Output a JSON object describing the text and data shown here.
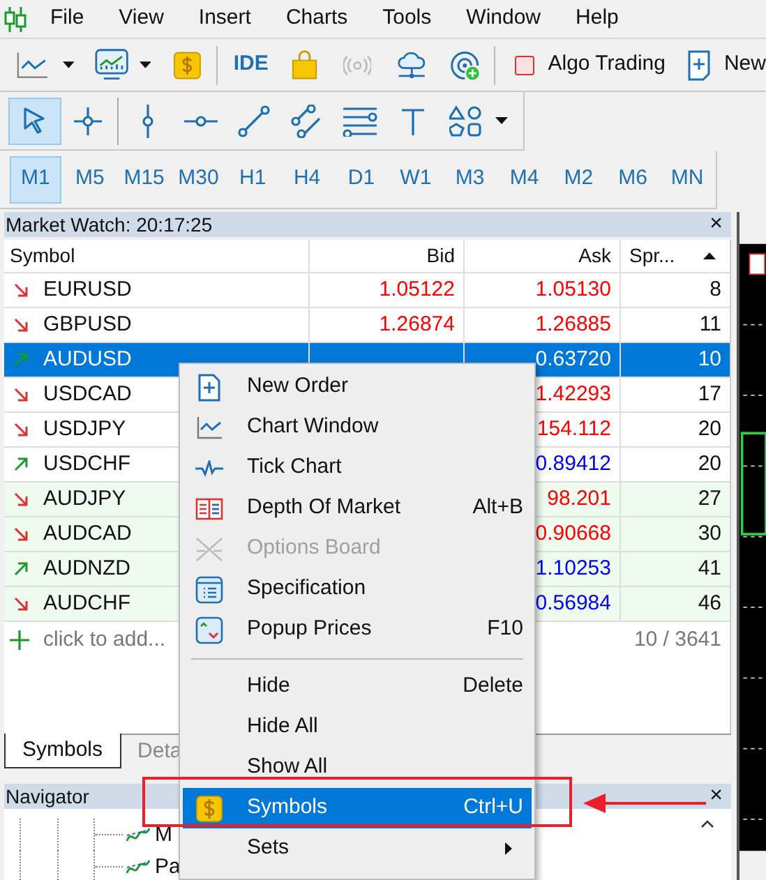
{
  "menubar": [
    "File",
    "View",
    "Insert",
    "Charts",
    "Tools",
    "Window",
    "Help"
  ],
  "toolbar": {
    "ide": "IDE",
    "algo_trading": {
      "label": "Algo Trading",
      "checked": false
    },
    "new_order": "New"
  },
  "drawing_tools": [
    {
      "kind": "cursor",
      "selected": true
    },
    {
      "kind": "crosshair",
      "selected": false
    },
    {
      "kind": "vline",
      "selected": false
    },
    {
      "kind": "hline",
      "selected": false
    },
    {
      "kind": "trend",
      "selected": false
    },
    {
      "kind": "channel",
      "selected": false
    },
    {
      "kind": "fibo",
      "selected": false
    },
    {
      "kind": "text",
      "selected": false
    },
    {
      "kind": "shapes",
      "selected": false
    }
  ],
  "timeframes": [
    {
      "label": "M1",
      "selected": true
    },
    {
      "label": "M5",
      "selected": false
    },
    {
      "label": "M15",
      "selected": false
    },
    {
      "label": "M30",
      "selected": false
    },
    {
      "label": "H1",
      "selected": false
    },
    {
      "label": "H4",
      "selected": false
    },
    {
      "label": "D1",
      "selected": false
    },
    {
      "label": "W1",
      "selected": false
    },
    {
      "label": "M3",
      "selected": false
    },
    {
      "label": "M4",
      "selected": false
    },
    {
      "label": "M2",
      "selected": false
    },
    {
      "label": "M6",
      "selected": false
    },
    {
      "label": "MN",
      "selected": false
    }
  ],
  "market_watch": {
    "title": "Market Watch: 20:17:25",
    "close": "×",
    "columns": [
      "Symbol",
      "Bid",
      "Ask",
      "Spr..."
    ],
    "rows": [
      {
        "symbol": "EURUSD",
        "rising": false,
        "selected": false,
        "tinted": false,
        "bid": {
          "value": "1.05122",
          "color": "#ff0000"
        },
        "ask": {
          "value": "1.05130",
          "color": "#ff0000"
        },
        "spread": "8"
      },
      {
        "symbol": "GBPUSD",
        "rising": false,
        "selected": false,
        "tinted": false,
        "bid": {
          "value": "1.26874",
          "color": "#ff0000"
        },
        "ask": {
          "value": "1.26885",
          "color": "#ff0000"
        },
        "spread": "11"
      },
      {
        "symbol": "AUDUSD",
        "rising": true,
        "selected": true,
        "tinted": false,
        "ask": {
          "value": "0.63720"
        },
        "spread": "10"
      },
      {
        "symbol": "USDCAD",
        "rising": false,
        "selected": false,
        "tinted": false,
        "ask": {
          "value": "1.42293",
          "color": "#ff0000"
        },
        "spread": "17"
      },
      {
        "symbol": "USDJPY",
        "rising": false,
        "selected": false,
        "tinted": false,
        "ask": {
          "value": "154.112",
          "color": "#ff0000"
        },
        "spread": "20"
      },
      {
        "symbol": "USDCHF",
        "rising": true,
        "selected": false,
        "tinted": false,
        "ask": {
          "value": "0.89412",
          "color": "#0000ff"
        },
        "spread": "20"
      },
      {
        "symbol": "AUDJPY",
        "rising": false,
        "selected": false,
        "tinted": true,
        "ask": {
          "value": "98.201",
          "color": "#ff0000"
        },
        "spread": "27"
      },
      {
        "symbol": "AUDCAD",
        "rising": false,
        "selected": false,
        "tinted": true,
        "ask": {
          "value": "0.90668",
          "color": "#ff0000"
        },
        "spread": "30"
      },
      {
        "symbol": "AUDNZD",
        "rising": true,
        "selected": false,
        "tinted": true,
        "ask": {
          "value": "1.10253",
          "color": "#0000ff"
        },
        "spread": "41"
      },
      {
        "symbol": "AUDCHF",
        "rising": false,
        "selected": false,
        "tinted": true,
        "ask": {
          "value": "0.56984",
          "color": "#0000ff"
        },
        "spread": "46"
      }
    ],
    "add_placeholder": "click to add...",
    "count": "10 / 3641",
    "tabs": [
      {
        "label": "Symbols",
        "selected": true
      },
      {
        "label": "Deta",
        "selected": false
      }
    ]
  },
  "navigator": {
    "title": "Navigator",
    "close": "×",
    "items": [
      {
        "label": "M"
      },
      {
        "label": "Pa"
      }
    ]
  },
  "context_menu": [
    {
      "kind": "order",
      "label": "New Order",
      "disabled": false,
      "selected": false
    },
    {
      "kind": "chart",
      "label": "Chart Window",
      "disabled": false,
      "selected": false
    },
    {
      "kind": "tick",
      "label": "Tick Chart",
      "disabled": false,
      "selected": false
    },
    {
      "kind": "depth",
      "label": "Depth Of Market",
      "shortcut": "Alt+B",
      "disabled": false,
      "selected": false
    },
    {
      "kind": "options",
      "label": "Options Board",
      "disabled": true,
      "selected": false
    },
    {
      "kind": "spec",
      "label": "Specification",
      "disabled": false,
      "selected": false
    },
    {
      "kind": "popup",
      "label": "Popup Prices",
      "shortcut": "F10",
      "disabled": false,
      "selected": false
    },
    {
      "kind": "separator"
    },
    {
      "kind": "plain",
      "label": "Hide",
      "shortcut": "Delete",
      "disabled": false,
      "selected": false
    },
    {
      "kind": "plain",
      "label": "Hide All",
      "disabled": false,
      "selected": false
    },
    {
      "kind": "plain",
      "label": "Show All",
      "disabled": false,
      "selected": false
    },
    {
      "kind": "symbols",
      "label": "Symbols",
      "shortcut": "Ctrl+U",
      "disabled": false,
      "selected": true
    },
    {
      "kind": "submenu",
      "label": "Sets",
      "disabled": false,
      "selected": false
    }
  ]
}
